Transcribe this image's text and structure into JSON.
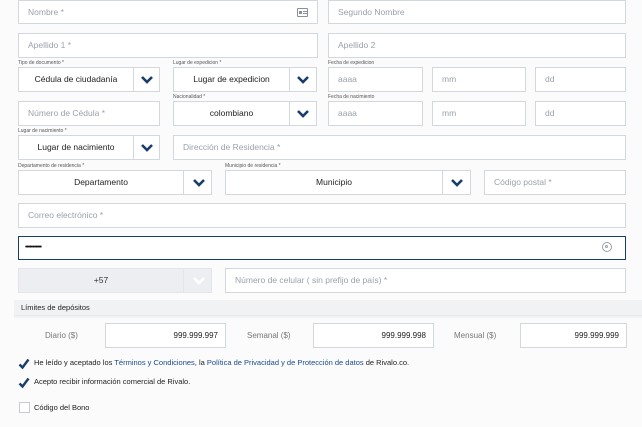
{
  "form": {
    "nombre_placeholder": "Nombre *",
    "segundo_nombre_placeholder": "Segundo Nombre",
    "apellido1_placeholder": "Apellido 1 *",
    "apellido2_placeholder": "Apellido 2",
    "tipo_doc_label": "Tipo de documento *",
    "tipo_doc_value": "Cédula de ciudadanía",
    "lugar_exp_label": "Lugar de expedicion *",
    "lugar_exp_value": "Lugar de expedicion",
    "fecha_exp_label": "Fecha de expedicion",
    "fecha_exp_year": "aaaa",
    "fecha_exp_month": "mm",
    "fecha_exp_day": "dd",
    "num_cedula_placeholder": "Número de Cédula *",
    "nacionalidad_label": "Nacionalidad *",
    "nacionalidad_value": "colombiano",
    "fecha_nac_label": "Fecha de nacimiento",
    "fecha_nac_year": "aaaa",
    "fecha_nac_month": "mm",
    "fecha_nac_day": "dd",
    "lugar_nac_label": "Lugar de nacimiento *",
    "lugar_nac_value": "Lugar de nacimiento",
    "direccion_placeholder": "Dirección de Residencia *",
    "depto_label": "Departamento de residencia *",
    "depto_value": "Departamento",
    "municipio_label": "Municipio de residencia *",
    "municipio_value": "Municipio",
    "codigo_postal_placeholder": "Código postal *",
    "correo_placeholder": "Correo electrónico *",
    "password_value": "•••••••••••",
    "prefix_value": "+57",
    "celular_placeholder": "Número de celular ( sin prefijo de país) *"
  },
  "deposits": {
    "title": "Límites de depósitos",
    "daily_label": "Diario ($)",
    "daily_value": "999.999.997",
    "weekly_label": "Semanal ($)",
    "weekly_value": "999.999.998",
    "monthly_label": "Mensual ($)",
    "monthly_value": "999.999.999"
  },
  "consents": {
    "terms_prefix": "He leído y aceptado los ",
    "terms_link": "Términos y Condiciones",
    "terms_mid": ", la ",
    "privacy_link": "Política de Privacidad y de Protección de datos",
    "terms_suffix": " de Rivalo.co.",
    "marketing_label": "Acepto recibir información comercial de Rivalo.",
    "bonus_label": "Código del Bono"
  },
  "colors": {
    "accent": "#1a3d6e",
    "focus_border": "#1a3d6e"
  }
}
